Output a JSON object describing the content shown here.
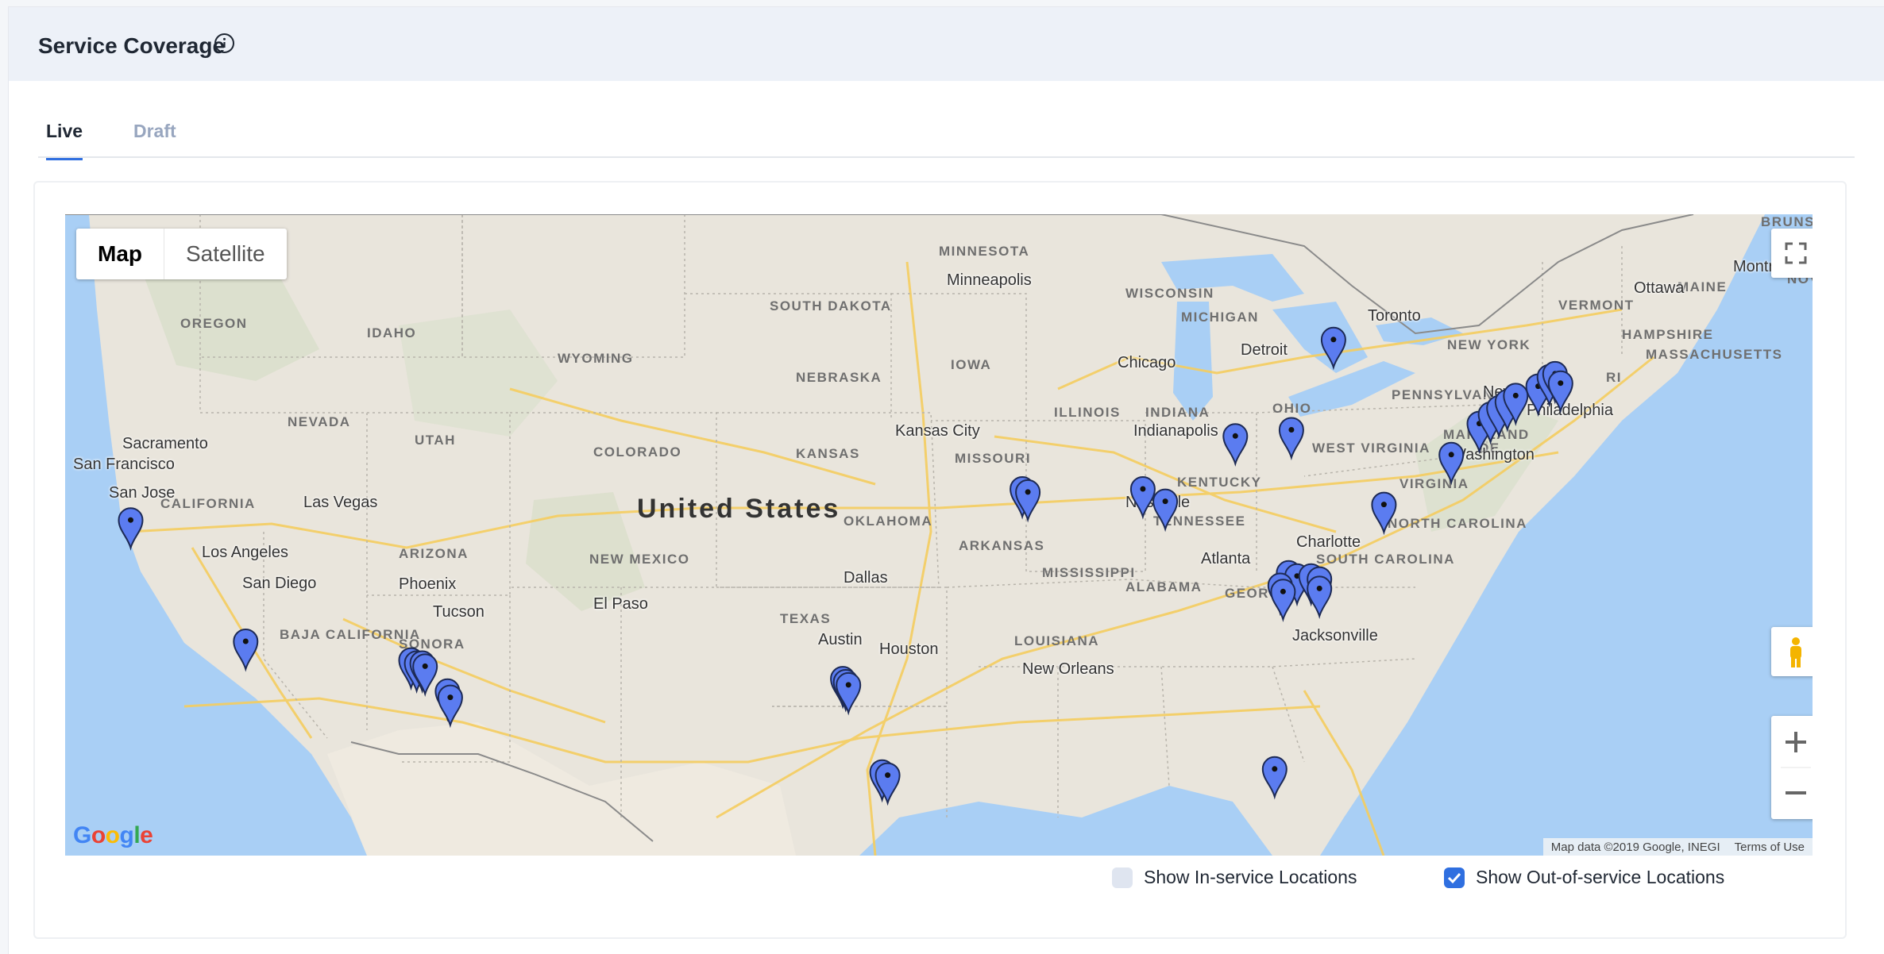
{
  "header": {
    "title": "Service Coverage",
    "icon": "info-circle-icon"
  },
  "tabs": [
    {
      "label": "Live",
      "active": true
    },
    {
      "label": "Draft",
      "active": false
    }
  ],
  "map": {
    "map_types": [
      "Map",
      "Satellite"
    ],
    "selected_map_type": "Map",
    "country_label": "United States",
    "state_labels": [
      "MINNESOTA",
      "WISCONSIN",
      "SOUTH DAKOTA",
      "OREGON",
      "IDAHO",
      "WYOMING",
      "NEBRASKA",
      "IOWA",
      "MICHIGAN",
      "NEW YORK",
      "VERMONT",
      "MAINE",
      "NEVADA",
      "UTAH",
      "COLORADO",
      "KANSAS",
      "MISSOURI",
      "ILLINOIS",
      "INDIANA",
      "OHIO",
      "PENNSYLVANIA",
      "WEST VIRGINIA",
      "KENTUCKY",
      "VIRGINIA",
      "MARYLAND",
      "DE",
      "NJ",
      "CALIFORNIA",
      "OKLAHOMA",
      "ARKANSAS",
      "TENNESSEE",
      "NORTH CAROLINA",
      "SOUTH CAROLINA",
      "NEW MEXICO",
      "MISSISSIPPI",
      "ALABAMA",
      "GEORGIA",
      "TEXAS",
      "LOUISIANA",
      "BAJA CALIFORNIA",
      "SONORA",
      "BRUNSWICK",
      "NOV",
      "HAMPSHIRE",
      "MASSACHUSETTS",
      "RI",
      "ARIZONA"
    ],
    "city_labels": [
      "Minneapolis",
      "Montreal",
      "Ottawa",
      "Toronto",
      "Detroit",
      "Chicago",
      "New York",
      "Philadelphia",
      "Washington",
      "Indianapolis",
      "Kansas City",
      "Sacramento",
      "San Francisco",
      "San Jose",
      "Las Vegas",
      "Los Angeles",
      "San Diego",
      "Phoenix",
      "Tucson",
      "El Paso",
      "Dallas",
      "Austin",
      "Houston",
      "Nashville",
      "Charlotte",
      "Atlanta",
      "Jacksonville",
      "New Orleans"
    ],
    "attribution": "Map data ©2019 Google, INEGI",
    "terms": "Terms of Use",
    "logo": "Google",
    "controls": [
      "fullscreen-icon",
      "pegman-icon",
      "zoom-in-icon",
      "zoom-out-icon"
    ],
    "marker_color": "#5b7cf0",
    "markers": [
      {
        "lat": 38.0,
        "lon": -122.3
      },
      {
        "lat": 34.1,
        "lon": -118.2
      },
      {
        "lat": 33.5,
        "lon": -112.3
      },
      {
        "lat": 33.4,
        "lon": -112.1
      },
      {
        "lat": 33.4,
        "lon": -111.9
      },
      {
        "lat": 33.3,
        "lon": -111.8
      },
      {
        "lat": 32.5,
        "lon": -111.0
      },
      {
        "lat": 32.3,
        "lon": -110.9
      },
      {
        "lat": 32.9,
        "lon": -96.9
      },
      {
        "lat": 32.8,
        "lon": -96.8
      },
      {
        "lat": 32.7,
        "lon": -96.7
      },
      {
        "lat": 29.9,
        "lon": -95.5
      },
      {
        "lat": 29.8,
        "lon": -95.3
      },
      {
        "lat": 39.0,
        "lon": -90.5
      },
      {
        "lat": 38.9,
        "lon": -90.3
      },
      {
        "lat": 39.0,
        "lon": -86.2
      },
      {
        "lat": 38.6,
        "lon": -85.4
      },
      {
        "lat": 40.7,
        "lon": -82.9
      },
      {
        "lat": 40.9,
        "lon": -80.9
      },
      {
        "lat": 43.8,
        "lon": -79.4
      },
      {
        "lat": 38.5,
        "lon": -77.6
      },
      {
        "lat": 36.3,
        "lon": -81.0
      },
      {
        "lat": 36.2,
        "lon": -80.7
      },
      {
        "lat": 35.9,
        "lon": -81.3
      },
      {
        "lat": 35.7,
        "lon": -81.2
      },
      {
        "lat": 36.2,
        "lon": -80.2
      },
      {
        "lat": 36.1,
        "lon": -79.9
      },
      {
        "lat": 35.8,
        "lon": -79.9
      },
      {
        "lat": 40.1,
        "lon": -75.2
      },
      {
        "lat": 41.1,
        "lon": -74.2
      },
      {
        "lat": 41.4,
        "lon": -73.8
      },
      {
        "lat": 41.6,
        "lon": -73.5
      },
      {
        "lat": 41.8,
        "lon": -73.2
      },
      {
        "lat": 42.0,
        "lon": -72.9
      },
      {
        "lat": 42.3,
        "lon": -72.1
      },
      {
        "lat": 42.6,
        "lon": -71.7
      },
      {
        "lat": 42.7,
        "lon": -71.5
      },
      {
        "lat": 42.4,
        "lon": -71.3
      },
      {
        "lat": 30.0,
        "lon": -81.5
      }
    ]
  },
  "legend": {
    "in_service": {
      "label": "Show In-service Locations",
      "checked": false
    },
    "out_of_service": {
      "label": "Show Out-of-service Locations",
      "checked": true
    }
  }
}
